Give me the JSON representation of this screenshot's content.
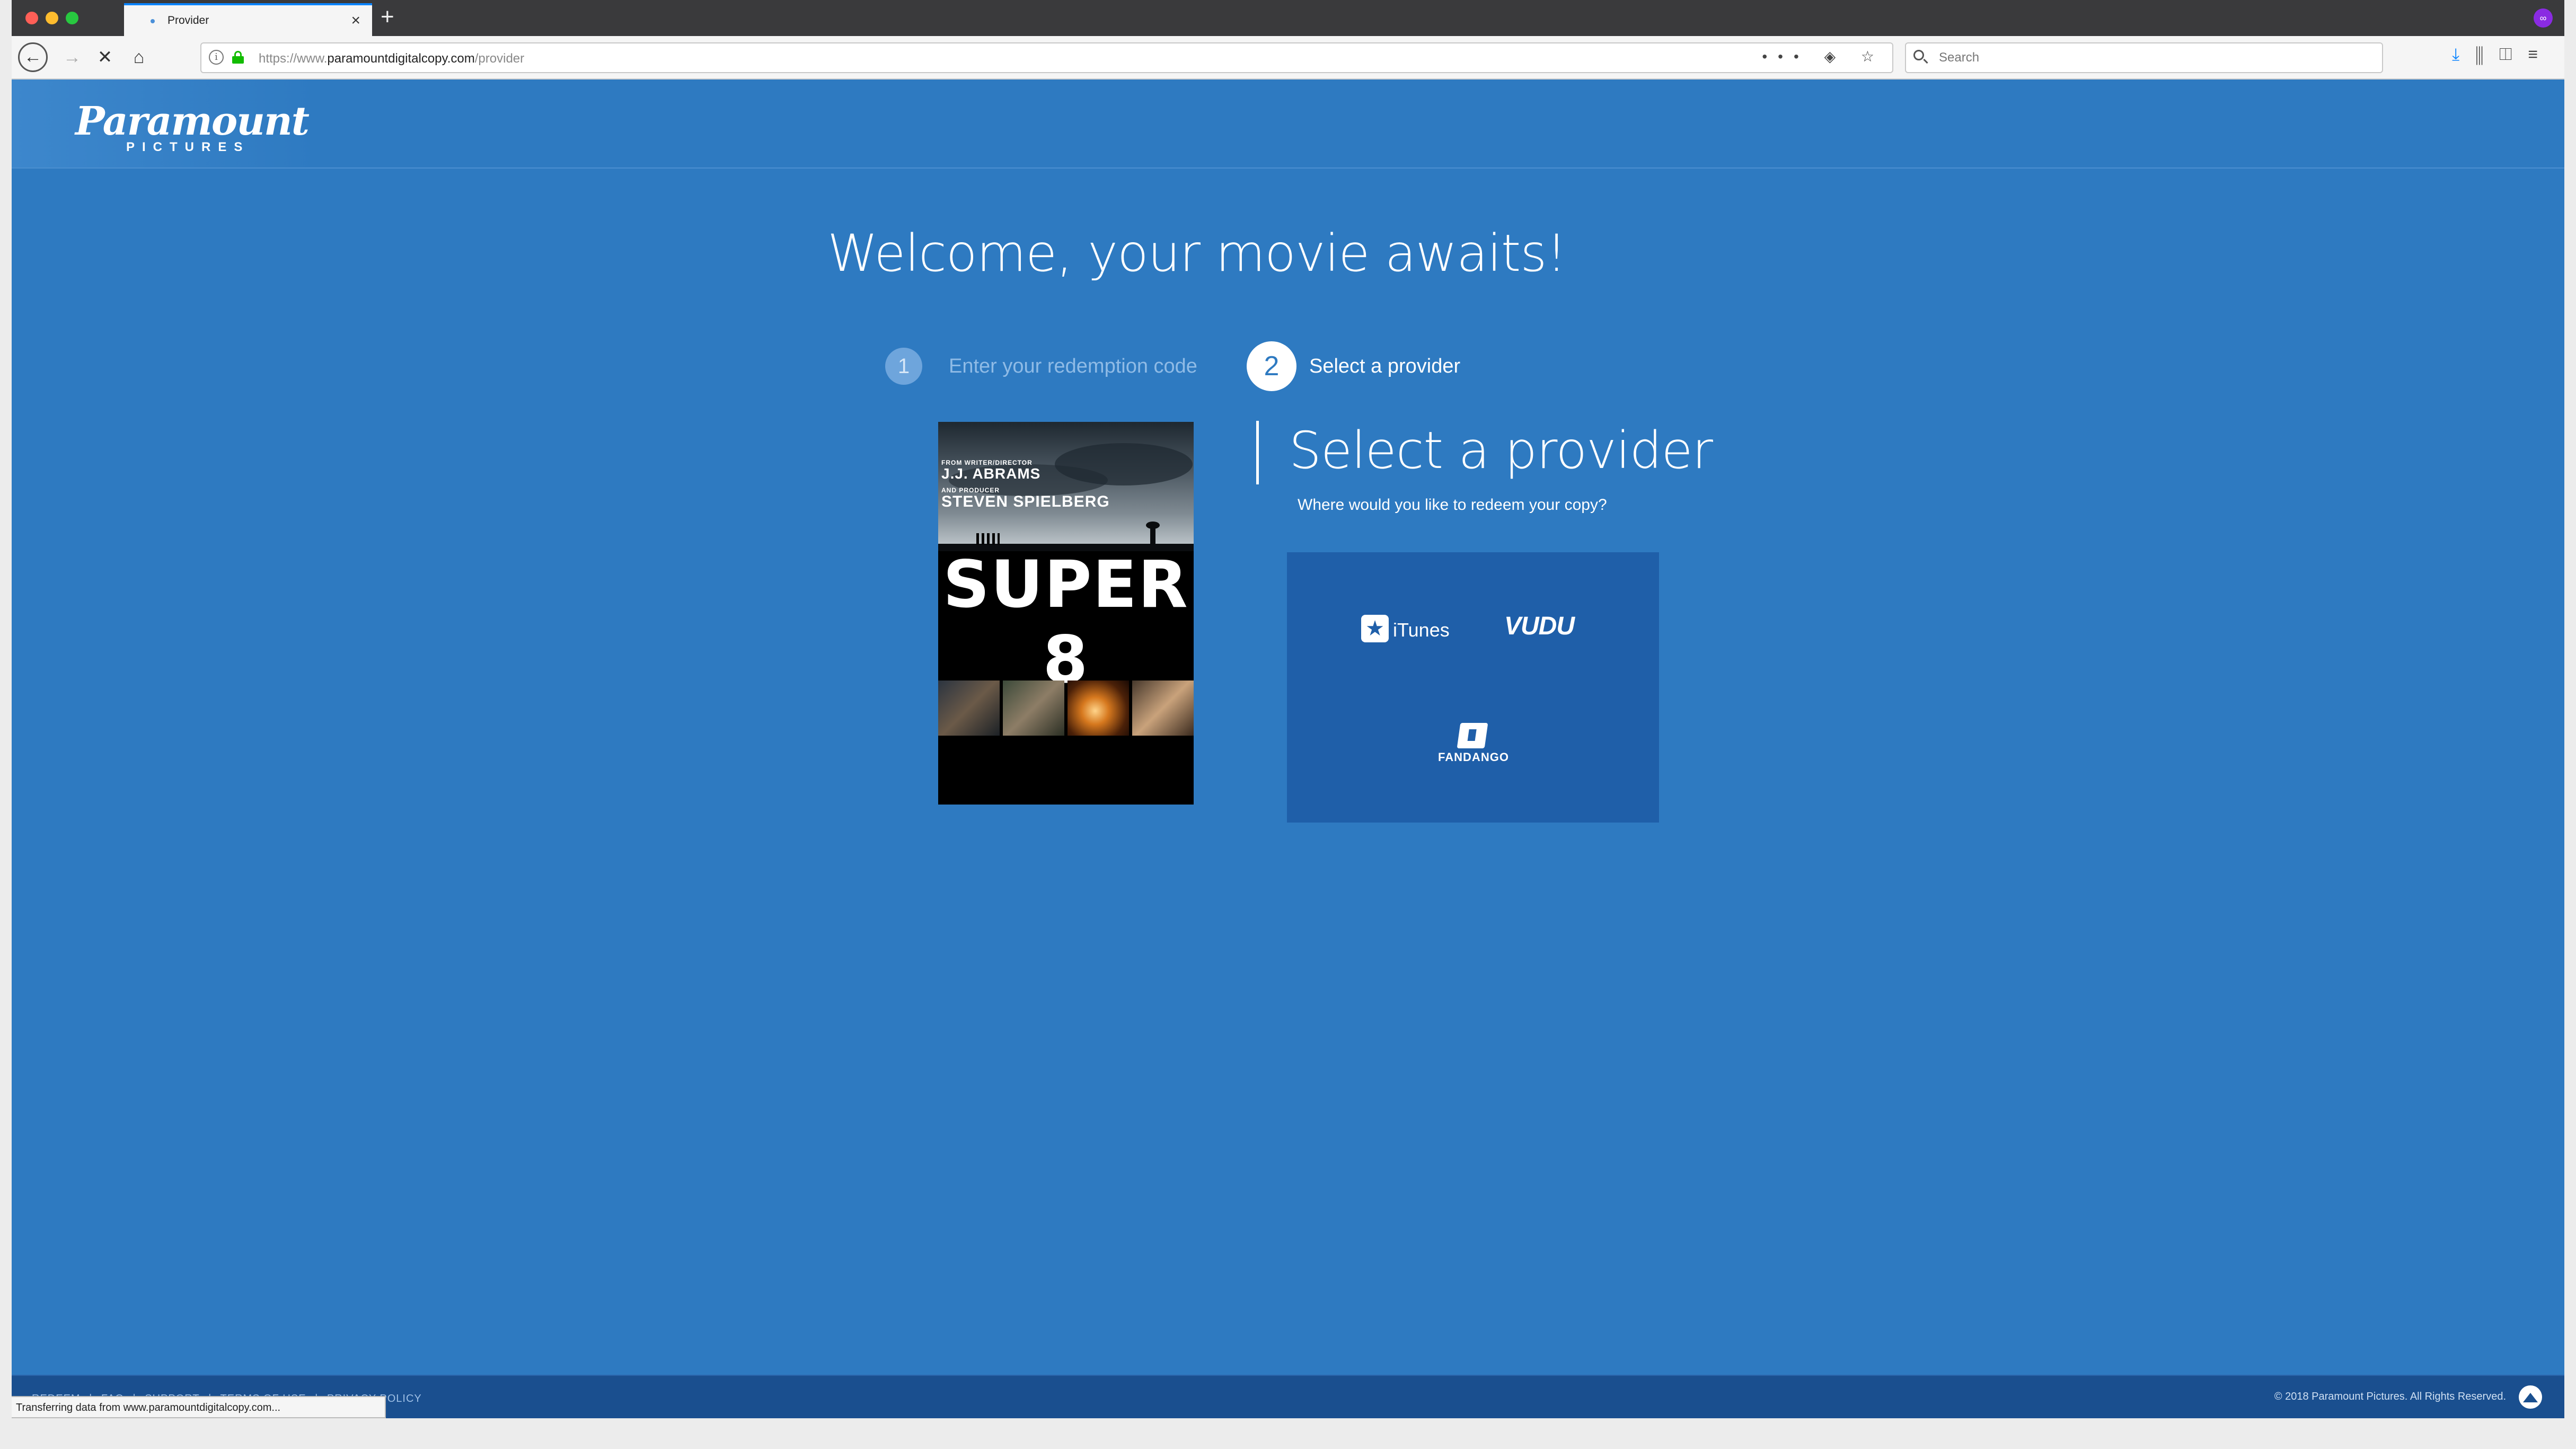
{
  "browser": {
    "tab_title": "Provider",
    "url_prefix": "https://www.",
    "url_host": "paramountdigitalcopy.com",
    "url_path": "/provider",
    "search_placeholder": "Search",
    "status_text": "Transferring data from www.paramountdigitalcopy.com..."
  },
  "header": {
    "logo_script": "Paramount",
    "logo_sub": "PICTURES"
  },
  "main": {
    "welcome": "Welcome, your movie awaits!",
    "steps": [
      {
        "number": "1",
        "label": "Enter your redemption code"
      },
      {
        "number": "2",
        "label": "Select a provider"
      }
    ],
    "poster": {
      "credit_small_1": "FROM WRITER/DIRECTOR",
      "credit_big_1": "J.J. ABRAMS",
      "credit_small_2": "AND PRODUCER",
      "credit_big_2": "STEVEN SPIELBERG",
      "title": "SUPER 8"
    },
    "provider": {
      "heading": "Select a provider",
      "subheading": "Where would you like to redeem your copy?",
      "options": [
        {
          "name": "iTunes",
          "icon": "itunes-star-icon"
        },
        {
          "name": "VUDU",
          "icon": "vudu-wordmark"
        },
        {
          "name": "FANDANGO",
          "icon": "fandango-f-icon"
        }
      ]
    }
  },
  "footer": {
    "links": [
      "REDEEM",
      "|",
      "FAQ",
      "|",
      "SUPPORT",
      "|",
      "TERMS OF USE",
      "|",
      "PRIVACY POLICY"
    ],
    "copyright": "© 2018 Paramount Pictures. All Rights Reserved."
  },
  "colors": {
    "page_blue": "#2e7ac1",
    "provider_box": "#1f5fa9",
    "footer": "#1a4f8f"
  }
}
